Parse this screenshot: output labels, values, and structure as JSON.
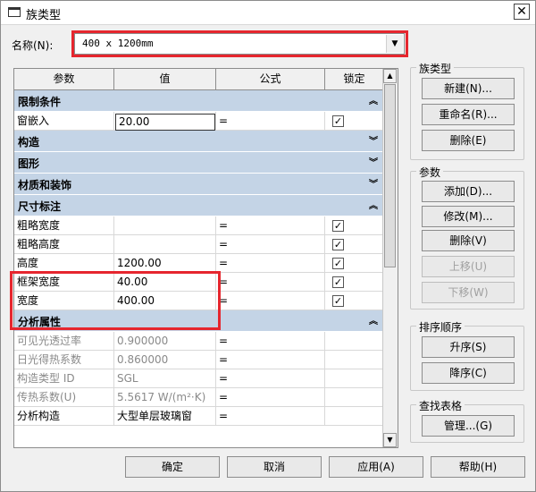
{
  "window": {
    "title": "族类型",
    "close_glyph": "✕"
  },
  "name_field": {
    "label": "名称(N):",
    "value": "400 x 1200mm",
    "dropdown_glyph": "▼"
  },
  "grid": {
    "headers": [
      "参数",
      "值",
      "公式",
      "锁定"
    ],
    "groups": [
      {
        "label": "限制条件",
        "chevron": "︽",
        "rows": [
          {
            "param": "窗嵌入",
            "value": "20.00",
            "formula": "=",
            "locked": true,
            "editing": true
          }
        ]
      },
      {
        "label": "构造",
        "chevron": "︾",
        "rows": []
      },
      {
        "label": "图形",
        "chevron": "︾",
        "rows": []
      },
      {
        "label": "材质和装饰",
        "chevron": "︾",
        "rows": []
      },
      {
        "label": "尺寸标注",
        "chevron": "︽",
        "rows": [
          {
            "param": "粗略宽度",
            "value": "",
            "formula": "=",
            "locked": true
          },
          {
            "param": "粗略高度",
            "value": "",
            "formula": "=",
            "locked": true
          },
          {
            "param": "高度",
            "value": "1200.00",
            "formula": "=",
            "locked": true
          },
          {
            "param": "框架宽度",
            "value": "40.00",
            "formula": "=",
            "locked": true
          },
          {
            "param": "宽度",
            "value": "400.00",
            "formula": "=",
            "locked": true
          }
        ]
      },
      {
        "label": "分析属性",
        "chevron": "︽",
        "rows": [
          {
            "param": "可见光透过率",
            "value": "0.900000",
            "formula": "=",
            "locked": false,
            "grey": true
          },
          {
            "param": "日光得热系数",
            "value": "0.860000",
            "formula": "=",
            "locked": false,
            "grey": true
          },
          {
            "param": "构造类型 ID",
            "value": "SGL",
            "formula": "=",
            "locked": false,
            "grey": true
          },
          {
            "param": "传热系数(U)",
            "value": "5.5617 W/(m²·K)",
            "formula": "=",
            "locked": false,
            "grey": true
          },
          {
            "param": "分析构造",
            "value": "大型单层玻璃窗",
            "formula": "=",
            "locked": false
          }
        ]
      }
    ],
    "check_glyph": "✓",
    "scroll_up_glyph": "▲",
    "scroll_down_glyph": "▼"
  },
  "side": {
    "family_types": {
      "title": "族类型",
      "buttons": [
        "新建(N)...",
        "重命名(R)...",
        "删除(E)"
      ]
    },
    "parameters": {
      "title": "参数",
      "buttons": [
        "添加(D)...",
        "修改(M)...",
        "删除(V)",
        "上移(U)",
        "下移(W)"
      ],
      "disabled": [
        false,
        false,
        false,
        true,
        true
      ]
    },
    "sort_order": {
      "title": "排序顺序",
      "buttons": [
        "升序(S)",
        "降序(C)"
      ]
    },
    "lookup_tables": {
      "title": "查找表格",
      "buttons": [
        "管理...(G)"
      ]
    }
  },
  "footer": {
    "buttons": [
      "确定",
      "取消",
      "应用(A)",
      "帮助(H)"
    ]
  },
  "colors": {
    "highlight": "#e6262e",
    "group_bg": "#c4d4e6"
  }
}
